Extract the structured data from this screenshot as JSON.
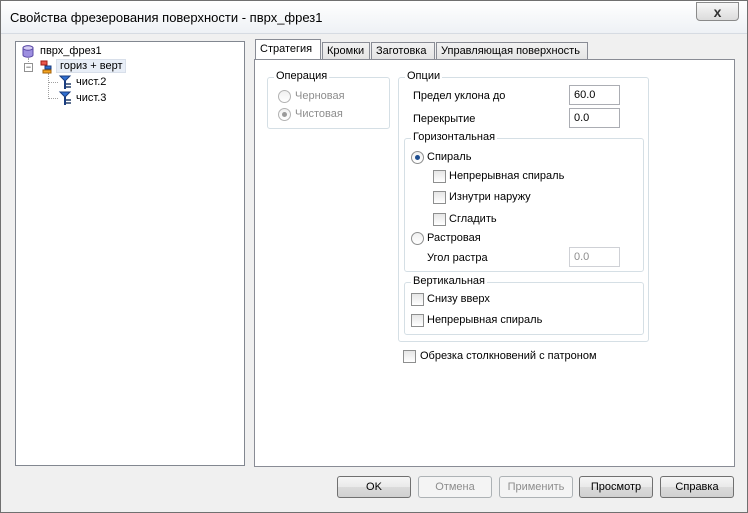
{
  "window": {
    "title": "Свойства фрезерования поверхности - пврх_фрез1",
    "close_label": "x"
  },
  "tree": {
    "root": "пврх_фрез1",
    "expander": "−",
    "group": "гориз + верт",
    "children": [
      "чист.2",
      "чист.3"
    ]
  },
  "tabs": [
    "Стратегия",
    "Кромки",
    "Заготовка",
    "Управляющая поверхность"
  ],
  "active_tab": "Стратегия",
  "operation": {
    "title": "Операция",
    "options": [
      "Черновая",
      "Чистовая"
    ],
    "selected": "Чистовая"
  },
  "options": {
    "title": "Опции",
    "slope_limit_label": "Предел уклона до",
    "slope_limit_value": "60.0",
    "overlap_label": "Перекрытие",
    "overlap_value": "0.0"
  },
  "horizontal": {
    "title": "Горизонтальная",
    "spiral_label": "Спираль",
    "spiral_selected": true,
    "continuous_spiral_label": "Непрерывная спираль",
    "inside_out_label": "Изнутри наружу",
    "smooth_label": "Сгладить",
    "raster_label": "Растровая",
    "raster_angle_label": "Угол растра",
    "raster_angle_value": "0.0"
  },
  "vertical": {
    "title": "Вертикальная",
    "bottom_up_label": "Снизу вверх",
    "continuous_spiral_label": "Непрерывная спираль"
  },
  "chuck_collision_label": "Обрезка столкновений с патроном",
  "buttons": {
    "ok": "OK",
    "cancel": "Отмена",
    "apply": "Применить",
    "preview": "Просмотр",
    "help": "Справка"
  }
}
